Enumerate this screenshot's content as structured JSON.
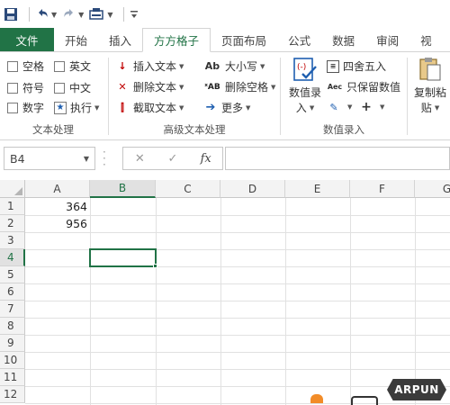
{
  "qat": {
    "icons": [
      "save-icon",
      "undo-icon",
      "redo-icon",
      "touch-mode-icon",
      "customize-icon"
    ]
  },
  "tabs": [
    {
      "label": "文件"
    },
    {
      "label": "开始"
    },
    {
      "label": "插入"
    },
    {
      "label": "方方格子"
    },
    {
      "label": "页面布局"
    },
    {
      "label": "公式"
    },
    {
      "label": "数据"
    },
    {
      "label": "审阅"
    },
    {
      "label": "视"
    }
  ],
  "ribbon": {
    "text_processing": {
      "label": "文本处理",
      "options": [
        "空格",
        "英文",
        "符号",
        "中文",
        "数字"
      ],
      "execute": "执行"
    },
    "advanced_text": {
      "label": "高级文本处理",
      "items": [
        "插入文本",
        "删除文本",
        "截取文本"
      ],
      "items2": [
        "大小写",
        "删除空格",
        "更多"
      ]
    },
    "numeric_entry": {
      "label": "数值录入",
      "big_button": "数值录",
      "big_button2": "入",
      "round": "四舍五入",
      "keep_values": "只保留数值"
    },
    "copy_paste": {
      "label1": "复制粘",
      "label2": "贴"
    }
  },
  "formula_bar": {
    "name_box": "B4",
    "fx": "fx",
    "value": ""
  },
  "grid": {
    "columns": [
      "A",
      "B",
      "C",
      "D",
      "E",
      "F",
      "G"
    ],
    "rows": [
      "1",
      "2",
      "3",
      "4",
      "5",
      "6",
      "7",
      "8",
      "9",
      "10",
      "11",
      "12"
    ],
    "selected_cell": "B4",
    "cells": {
      "A1": "364",
      "A2": "956"
    }
  },
  "watermark": "ARPUN",
  "colors": {
    "accent": "#217346",
    "header_bg": "#f3f3f3",
    "gridline": "#e1e1e1"
  }
}
